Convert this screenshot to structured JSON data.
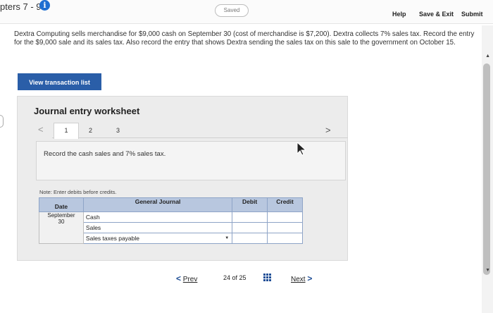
{
  "header": {
    "chapter_label": "pters 7 - 9",
    "saved_label": "Saved",
    "help_label": "Help",
    "save_exit_label": "Save & Exit",
    "submit_label": "Submit"
  },
  "prompt": {
    "text": "Dextra Computing sells merchandise for $9,000 cash on September 30 (cost of merchandise is $7,200). Dextra collects 7% sales tax. Record the entry for the $9,000 sale and its sales tax. Also record the entry that shows Dextra sending the sales tax on this sale to the government on October 15."
  },
  "buttons": {
    "view_transactions": "View transaction list"
  },
  "worksheet": {
    "title": "Journal entry worksheet",
    "tabs": [
      "1",
      "2",
      "3"
    ],
    "active_tab": "1",
    "description": "Record the cash sales and 7% sales tax.",
    "note": "Note: Enter debits before credits."
  },
  "journal": {
    "headers": {
      "date": "Date",
      "general_journal": "General Journal",
      "debit": "Debit",
      "credit": "Credit"
    },
    "date_month": "September",
    "date_day": "30",
    "rows": [
      {
        "account": "Cash",
        "debit": "",
        "credit": ""
      },
      {
        "account": "Sales",
        "debit": "",
        "credit": ""
      },
      {
        "account": "Sales taxes payable",
        "debit": "",
        "credit": ""
      }
    ]
  },
  "pagination": {
    "prev_label": "Prev",
    "counter": "24 of 25",
    "next_label": "Next"
  },
  "colors": {
    "primary_button": "#2a5ea8",
    "table_header": "#b8c7df",
    "info_icon": "#1f6fd1"
  },
  "icons": {
    "info": "info-icon",
    "cursor": "cursor-icon",
    "grid": "grid-icon"
  }
}
